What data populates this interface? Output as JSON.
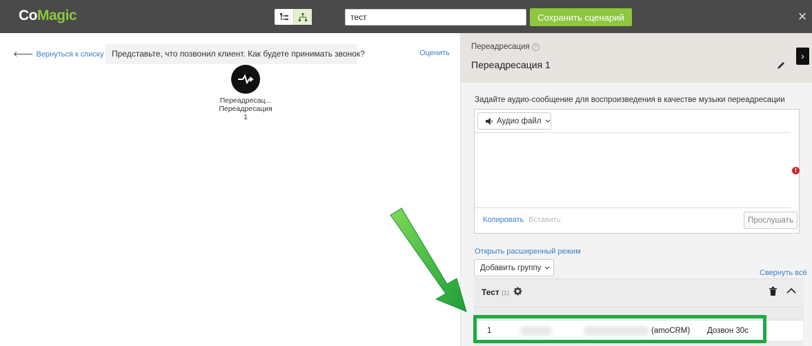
{
  "header": {
    "logo_prefix": "Co",
    "logo_suffix": "Magic",
    "scenario_name_value": "тест",
    "save_label": "Сохранить сценарий",
    "close_symbol": "×"
  },
  "canvas": {
    "back_label": "Вернуться к списку сцена",
    "hint": "Представьте, что позвонил клиент. Как будете принимать звонок?",
    "rate_label": "Оценить",
    "node": {
      "label_line1": "Переадресац...",
      "label_line2": "Переадресация",
      "label_line3": "1"
    }
  },
  "panel": {
    "type_label": "Переадресация",
    "help_symbol": "?",
    "title": "Переадресация 1",
    "collapse_symbol": "›",
    "message_label": "Задайте аудио-сообщение для воспроизведения в качестве музыки переадресации",
    "audio_button_label": "Аудио файл",
    "error_symbol": "!",
    "copy_label": "Копировать",
    "paste_label": "Вставить",
    "listen_label": "Прослушать",
    "advanced_label": "Открыть расширенный режим",
    "add_group_label": "Добавить группу",
    "collapse_all_label": "Свернуть всё",
    "group": {
      "name": "Тест",
      "count": "(1)",
      "row": {
        "num": "1",
        "source": "(amoCRM)",
        "dial": "Дозвон 30с"
      }
    }
  },
  "colors": {
    "topbar": "#4a4a4a",
    "accent": "#8dc63f",
    "link": "#3b7ec8",
    "annotation": "#20a942"
  }
}
